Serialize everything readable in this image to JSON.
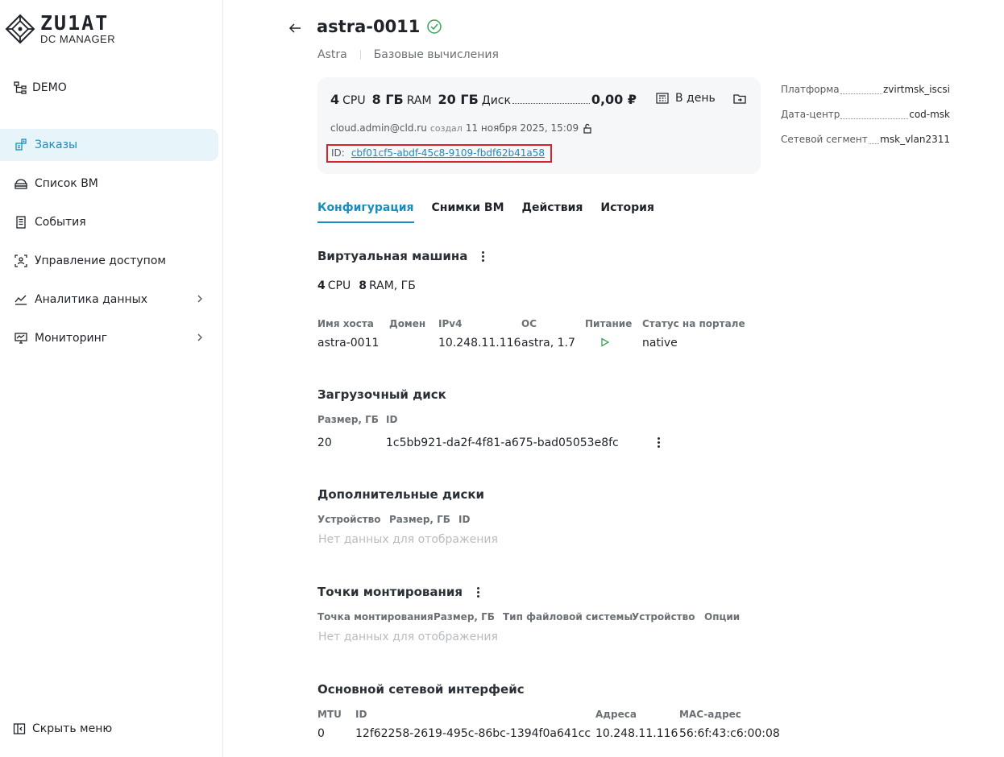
{
  "sidebar": {
    "logo_main": "ZU1AT",
    "logo_sub": "DC MANAGER",
    "project": "DEMO",
    "items": [
      {
        "label": "Заказы",
        "icon": "orders-icon"
      },
      {
        "label": "Список ВМ",
        "icon": "vm-list-icon"
      },
      {
        "label": "События",
        "icon": "events-icon"
      },
      {
        "label": "Управление доступом",
        "icon": "access-icon"
      },
      {
        "label": "Аналитика данных",
        "icon": "analytics-icon"
      },
      {
        "label": "Мониторинг",
        "icon": "monitoring-icon"
      }
    ],
    "hide_menu": "Скрыть меню"
  },
  "header": {
    "title": "astra-0011",
    "breadcrumb_1": "Astra",
    "breadcrumb_2": "Базовые вычисления"
  },
  "card": {
    "cpu_value": "4",
    "cpu_unit": "CPU",
    "ram_value": "8 ГБ",
    "ram_unit": "RAM",
    "disk_value": "20 ГБ",
    "disk_unit": "Диск",
    "price": "0,00 ₽",
    "period": "В день",
    "creator": "cloud.admin@cld.ru",
    "created_label": "создал",
    "created_at": "11 ноября 2025, 15:09",
    "id_label": "ID:",
    "id_value": "cbf01cf5-abdf-45c8-9109-fbdf62b41a58"
  },
  "meta": {
    "platform_label": "Платформа",
    "platform_value": "zvirtmsk_iscsi",
    "dc_label": "Дата-центр",
    "dc_value": "cod-msk",
    "segment_label": "Сетевой сегмент",
    "segment_value": "msk_vlan2311"
  },
  "tabs": [
    "Конфигурация",
    "Снимки ВМ",
    "Действия",
    "История"
  ],
  "vm": {
    "title": "Виртуальная машина",
    "cpu_value": "4",
    "cpu_unit": "CPU",
    "ram_value": "8",
    "ram_unit": "RAM, ГБ",
    "headers": [
      "Имя хоста",
      "Домен",
      "IPv4",
      "ОС",
      "Питание",
      "Статус на портале"
    ],
    "hostname": "astra-0011",
    "domain": "",
    "ipv4": "10.248.11.116",
    "os": "astra, 1.7",
    "status": "native"
  },
  "boot_disk": {
    "title": "Загрузочный диск",
    "headers": [
      "Размер, ГБ",
      "ID"
    ],
    "size": "20",
    "id": "1c5bb921-da2f-4f81-a675-bad05053e8fc"
  },
  "extra_disks": {
    "title": "Дополнительные диски",
    "headers": [
      "Устройство",
      "Размер, ГБ",
      "ID"
    ],
    "empty": "Нет данных для отображения"
  },
  "mounts": {
    "title": "Точки монтирования",
    "headers": [
      "Точка монтирования",
      "Размер, ГБ",
      "Тип файловой системы",
      "Устройство",
      "Опции"
    ],
    "empty": "Нет данных для отображения"
  },
  "network": {
    "title": "Основной сетевой интерфейс",
    "headers": [
      "MTU",
      "ID",
      "Адреса",
      "MAC-адрес"
    ],
    "mtu": "0",
    "id": "12f62258-2619-495c-86bc-1394f0a641cc",
    "address": "10.248.11.116",
    "mac": "56:6f:43:c6:00:08"
  },
  "colors": {
    "accent": "#1a8dbf",
    "active_bg": "#e7f5fa",
    "success": "#3aa35b",
    "highlight": "#d8232a"
  }
}
